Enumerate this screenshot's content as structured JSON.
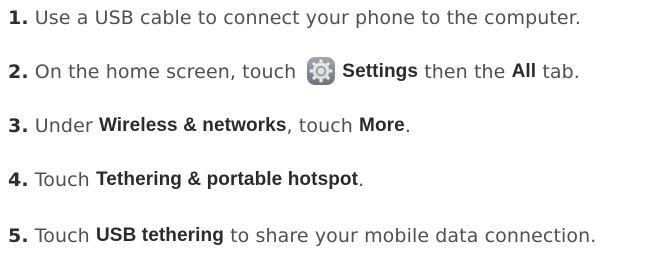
{
  "steps": [
    {
      "number": "1.",
      "parts": [
        "Use a USB cable to connect your phone to the computer."
      ]
    },
    {
      "number": "2.",
      "parts": [
        "On the home screen, touch",
        "Settings",
        "then the",
        "All",
        "tab."
      ],
      "icon": "settings-gear-icon"
    },
    {
      "number": "3.",
      "parts": [
        "Under",
        "Wireless & networks",
        ", touch",
        "More",
        "."
      ]
    },
    {
      "number": "4.",
      "parts": [
        "Touch",
        "Tethering & portable hotspot",
        "."
      ]
    },
    {
      "number": "5.",
      "parts": [
        "Touch",
        "USB tethering",
        "to share your mobile data connection."
      ]
    }
  ],
  "colors": {
    "icon_base": "#8a8f96",
    "icon_highlight": "#e6e8ea",
    "text": "#505050",
    "bold": "#2b2b2b"
  }
}
